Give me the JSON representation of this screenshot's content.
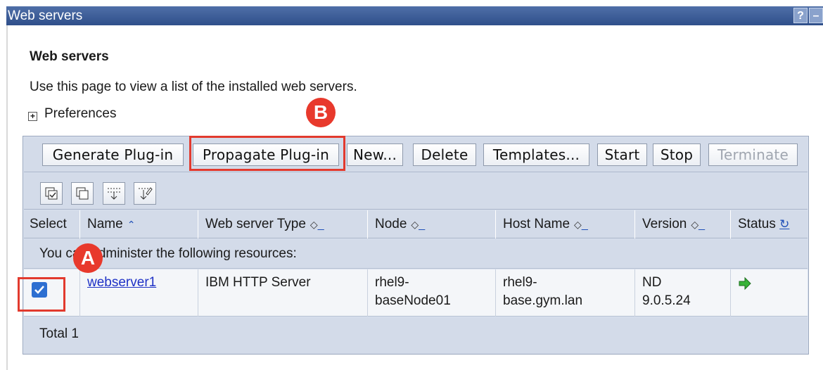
{
  "window": {
    "title": "Web servers",
    "help_label": "?",
    "min_label": "–"
  },
  "page": {
    "title": "Web servers",
    "description": "Use this page to view a list of the installed web servers.",
    "preferences_label": "Preferences"
  },
  "toolbar": {
    "buttons": [
      {
        "label": "Generate Plug-in",
        "enabled": true
      },
      {
        "label": "Propagate Plug-in",
        "enabled": true
      },
      {
        "label": "New...",
        "enabled": true
      },
      {
        "label": "Delete",
        "enabled": true
      },
      {
        "label": "Templates...",
        "enabled": true
      },
      {
        "label": "Start",
        "enabled": true
      },
      {
        "label": "Stop",
        "enabled": true
      },
      {
        "label": "Terminate",
        "enabled": false
      }
    ],
    "icons": [
      "select-all-icon",
      "deselect-all-icon",
      "show-filter-icon",
      "clear-filter-icon"
    ]
  },
  "table": {
    "columns": [
      {
        "label": "Select"
      },
      {
        "label": "Name"
      },
      {
        "label": "Web server Type"
      },
      {
        "label": "Node"
      },
      {
        "label": "Host Name"
      },
      {
        "label": "Version"
      },
      {
        "label": "Status"
      }
    ],
    "message": "You can administer the following resources:",
    "rows": [
      {
        "selected": true,
        "name": "webserver1",
        "type": "IBM HTTP Server",
        "node_line1": "rhel9-",
        "node_line2": "baseNode01",
        "host_line1": "rhel9-",
        "host_line2": "base.gym.lan",
        "version_line1": "ND",
        "version_line2": "9.0.5.24",
        "status_icon": "started-arrow-icon"
      }
    ],
    "total": "Total 1"
  },
  "annotations": {
    "marker_a": "A",
    "marker_b": "B"
  },
  "colors": {
    "title_bar": "#2f4f8a",
    "accent_red": "#e23a2e",
    "link": "#1f32c6",
    "status_green": "#2a9a2a"
  }
}
